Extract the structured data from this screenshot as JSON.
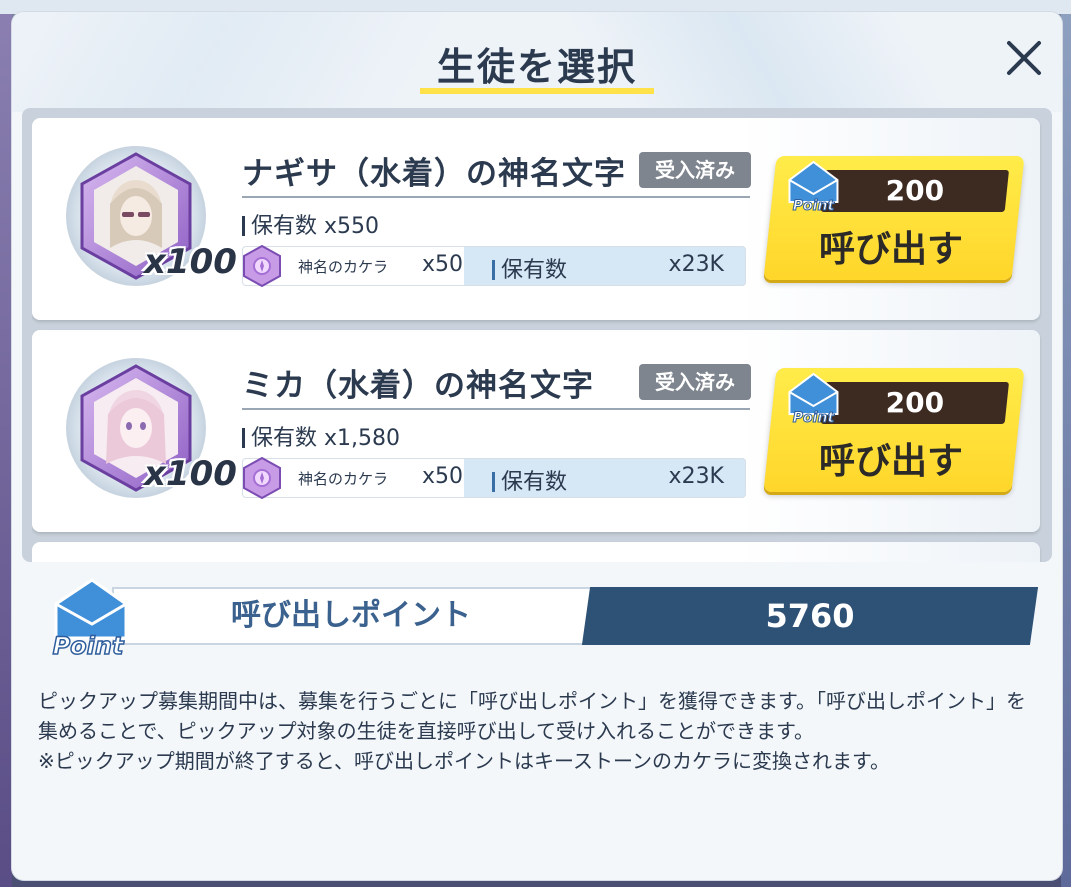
{
  "header": {
    "title": "生徒を選択",
    "close_label": "×"
  },
  "items": [
    {
      "name": "ナギサ（水着）の神名文字",
      "badge": "受入済み",
      "quantity": "x100",
      "owned": "保有数 x550",
      "eleph_label": "神名のカケラ",
      "eleph_cost": "x50",
      "eleph_owned_label": "保有数",
      "eleph_owned_value": "x23K",
      "summon_cost": "200",
      "summon_label": "呼び出す",
      "point_icon_text": "Point"
    },
    {
      "name": "ミカ（水着）の神名文字",
      "badge": "受入済み",
      "quantity": "x100",
      "owned": "保有数 x1,580",
      "eleph_label": "神名のカケラ",
      "eleph_cost": "x50",
      "eleph_owned_label": "保有数",
      "eleph_owned_value": "x23K",
      "summon_cost": "200",
      "summon_label": "呼び出す",
      "point_icon_text": "Point"
    }
  ],
  "points": {
    "label": "呼び出しポイント",
    "value": "5760",
    "icon_text": "Point"
  },
  "description": {
    "line1": "ピックアップ募集期間中は、募集を行うごとに「呼び出しポイント」を獲得できます。「呼び出しポイント」を集めることで、ピックアップ対象の生徒を直接呼び出して受け入れることができます。",
    "line2": "※ピックアップ期間が終了すると、呼び出しポイントはキーストーンのカケラに変換されます。"
  },
  "colors": {
    "button_yellow": "#ffd62a",
    "points_dark": "#2e5176",
    "badge_gray": "#7e858e",
    "title_underline": "#ffe24a"
  }
}
